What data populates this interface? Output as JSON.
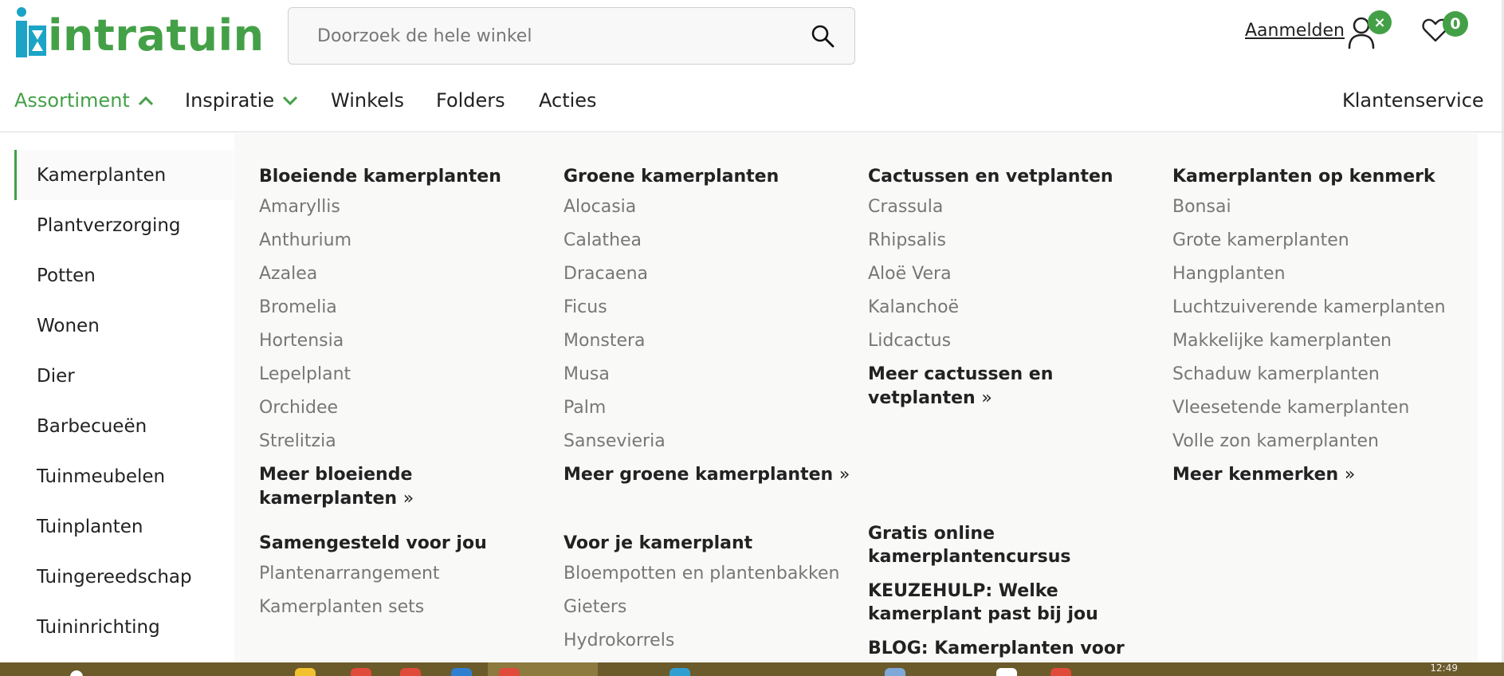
{
  "logo": {
    "text": "intratuin",
    "brand_color": "#44a047",
    "accent_color": "#1ba4c5"
  },
  "search": {
    "placeholder": "Doorzoek de hele winkel",
    "value": "",
    "icon": "search-icon"
  },
  "account": {
    "login_label": "Aanmelden",
    "login_badge": "×",
    "user_icon": "user-icon"
  },
  "wishlist": {
    "icon": "heart-icon",
    "count": "0"
  },
  "nav": {
    "assortiment": "Assortiment",
    "inspiratie": "Inspiratie",
    "winkels": "Winkels",
    "folders": "Folders",
    "acties": "Acties",
    "klantenservice": "Klantenservice"
  },
  "sidebar": {
    "items": [
      {
        "label": "Kamerplanten"
      },
      {
        "label": "Plantverzorging"
      },
      {
        "label": "Potten"
      },
      {
        "label": "Wonen"
      },
      {
        "label": "Dier"
      },
      {
        "label": "Barbecueën"
      },
      {
        "label": "Tuinmeubelen"
      },
      {
        "label": "Tuinplanten"
      },
      {
        "label": "Tuingereedschap"
      },
      {
        "label": "Tuininrichting"
      }
    ]
  },
  "menu": {
    "bloeiende": {
      "title": "Bloeiende kamerplanten",
      "links": [
        "Amaryllis",
        "Anthurium",
        "Azalea",
        "Bromelia",
        "Hortensia",
        "Lepelplant",
        "Orchidee",
        "Strelitzia"
      ],
      "more": "Meer bloeiende kamerplanten",
      "more_arrow": "»"
    },
    "groene": {
      "title": "Groene kamerplanten",
      "links": [
        "Alocasia",
        "Calathea",
        "Dracaena",
        "Ficus",
        "Monstera",
        "Musa",
        "Palm",
        "Sansevieria"
      ],
      "more": "Meer groene kamerplanten",
      "more_arrow": "»"
    },
    "cactussen": {
      "title": "Cactussen en vetplanten",
      "links": [
        "Crassula",
        "Rhipsalis",
        "Aloë Vera",
        "Kalanchoë",
        "Lidcactus"
      ],
      "more": "Meer cactussen en vetplanten",
      "more_arrow": "»"
    },
    "kenmerk": {
      "title": "Kamerplanten op kenmerk",
      "links": [
        "Bonsai",
        "Grote kamerplanten",
        "Hangplanten",
        "Luchtzuiverende kamerplanten",
        "Makkelijke kamerplanten",
        "Schaduw kamerplanten",
        "Vleesetende kamerplanten",
        "Volle zon kamerplanten"
      ],
      "more": "Meer kenmerken",
      "more_arrow": "»"
    },
    "samengesteld": {
      "title": "Samengesteld voor jou",
      "links": [
        "Plantenarrangement",
        "Kamerplanten sets"
      ]
    },
    "voorje": {
      "title": "Voor je kamerplant",
      "links": [
        "Bloempotten en plantenbakken",
        "Gieters",
        "Hydrokorrels"
      ]
    },
    "features": [
      "Gratis online kamerplantencursus",
      "KEUZEHULP: Welke kamerplant past bij jou",
      "BLOG: Kamerplanten voor"
    ]
  },
  "taskbar": {
    "time": "12:49"
  }
}
